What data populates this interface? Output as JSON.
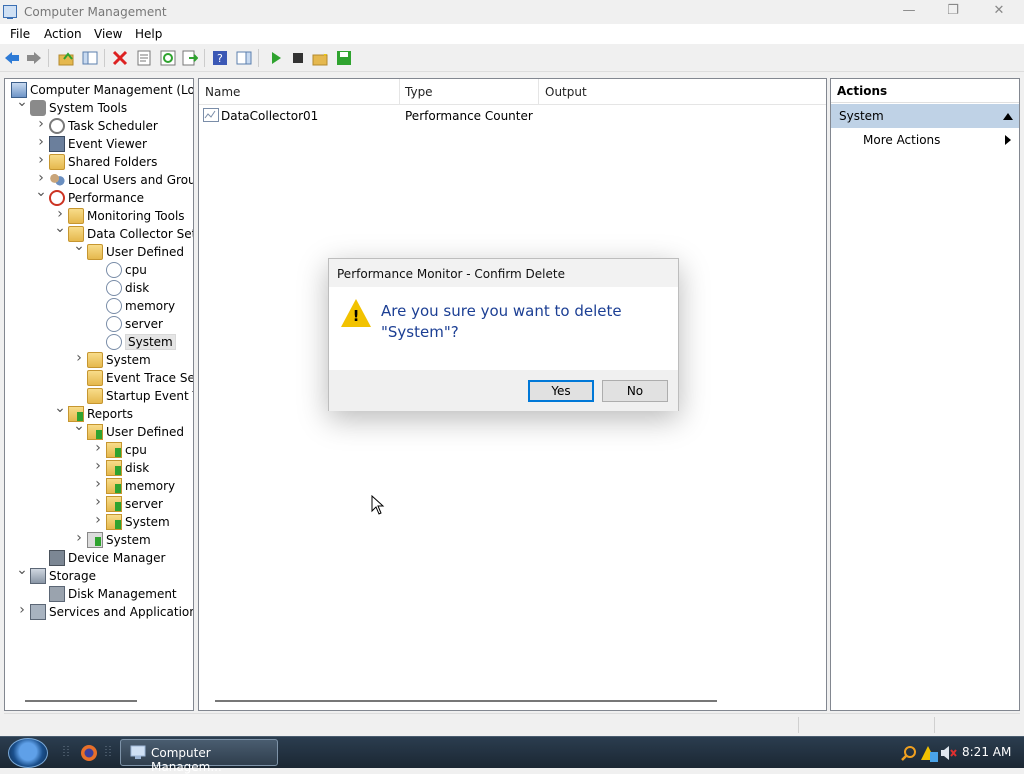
{
  "window": {
    "title": "Computer Management",
    "controls": {
      "minimize": "—",
      "restore": "❐",
      "close": "✕"
    }
  },
  "menu": [
    "File",
    "Action",
    "View",
    "Help"
  ],
  "toolbar": {
    "icons": [
      "back-icon",
      "forward-icon",
      "up-icon",
      "show-hide-tree-icon",
      "delete-icon",
      "properties-icon",
      "refresh-icon",
      "export-icon",
      "help-icon",
      "show-hide-pane-icon",
      "start-icon",
      "stop-icon",
      "new-icon",
      "save-icon"
    ]
  },
  "tree": [
    {
      "label": "Computer Management (Local",
      "depth": 0,
      "expander": "",
      "icon": "computer-icon"
    },
    {
      "label": "System Tools",
      "depth": 1,
      "expander": "v",
      "icon": "tools-icon"
    },
    {
      "label": "Task Scheduler",
      "depth": 2,
      "expander": ">",
      "icon": "clock-icon"
    },
    {
      "label": "Event Viewer",
      "depth": 2,
      "expander": ">",
      "icon": "event-viewer-icon"
    },
    {
      "label": "Shared Folders",
      "depth": 2,
      "expander": ">",
      "icon": "folder-icon"
    },
    {
      "label": "Local Users and Groups",
      "depth": 2,
      "expander": ">",
      "icon": "users-icon"
    },
    {
      "label": "Performance",
      "depth": 2,
      "expander": "v",
      "icon": "performance-icon"
    },
    {
      "label": "Monitoring Tools",
      "depth": 3,
      "expander": ">",
      "icon": "folder-icon"
    },
    {
      "label": "Data Collector Sets",
      "depth": 3,
      "expander": "v",
      "icon": "folder-icon"
    },
    {
      "label": "User Defined",
      "depth": 4,
      "expander": "v",
      "icon": "folder-user-icon"
    },
    {
      "label": "cpu",
      "depth": 5,
      "expander": "",
      "icon": "data-collector-icon"
    },
    {
      "label": "disk",
      "depth": 5,
      "expander": "",
      "icon": "data-collector-icon"
    },
    {
      "label": "memory",
      "depth": 5,
      "expander": "",
      "icon": "data-collector-icon"
    },
    {
      "label": "server",
      "depth": 5,
      "expander": "",
      "icon": "data-collector-icon"
    },
    {
      "label": "System",
      "depth": 5,
      "expander": "",
      "icon": "data-collector-icon",
      "selected": true
    },
    {
      "label": "System",
      "depth": 4,
      "expander": ">",
      "icon": "folder-icon"
    },
    {
      "label": "Event Trace Sess",
      "depth": 4,
      "expander": "",
      "icon": "folder-icon"
    },
    {
      "label": "Startup Event Tra",
      "depth": 4,
      "expander": "",
      "icon": "folder-icon"
    },
    {
      "label": "Reports",
      "depth": 3,
      "expander": "v",
      "icon": "reports-icon"
    },
    {
      "label": "User Defined",
      "depth": 4,
      "expander": "v",
      "icon": "reports-icon"
    },
    {
      "label": "cpu",
      "depth": 5,
      "expander": ">",
      "icon": "reports-icon"
    },
    {
      "label": "disk",
      "depth": 5,
      "expander": ">",
      "icon": "reports-icon"
    },
    {
      "label": "memory",
      "depth": 5,
      "expander": ">",
      "icon": "reports-icon"
    },
    {
      "label": "server",
      "depth": 5,
      "expander": ">",
      "icon": "reports-icon"
    },
    {
      "label": "System",
      "depth": 5,
      "expander": ">",
      "icon": "reports-icon"
    },
    {
      "label": "System",
      "depth": 4,
      "expander": ">",
      "icon": "reports-system-icon"
    },
    {
      "label": "Device Manager",
      "depth": 2,
      "expander": "",
      "icon": "device-manager-icon"
    },
    {
      "label": "Storage",
      "depth": 1,
      "expander": "v",
      "icon": "storage-icon"
    },
    {
      "label": "Disk Management",
      "depth": 2,
      "expander": "",
      "icon": "disk-management-icon"
    },
    {
      "label": "Services and Applications",
      "depth": 1,
      "expander": ">",
      "icon": "services-icon"
    }
  ],
  "list": {
    "columns": [
      "Name",
      "Type",
      "Output"
    ],
    "rows": [
      {
        "name": "DataCollector01",
        "type": "Performance Counter",
        "output": ""
      }
    ]
  },
  "actions": {
    "header": "Actions",
    "section": "System",
    "items": [
      "More Actions"
    ]
  },
  "dialog": {
    "title": "Performance Monitor - Confirm Delete",
    "message": "Are you sure you want to delete \"System\"?",
    "yes": "Yes",
    "no": "No"
  },
  "taskbar": {
    "task_label": "Computer Managem...",
    "clock": "8:21 AM"
  },
  "colors": {
    "accent": "#0078d7",
    "message_text": "#1c3f94",
    "actions_section_bg": "#bfd2e6",
    "warning": "#f2c200"
  }
}
